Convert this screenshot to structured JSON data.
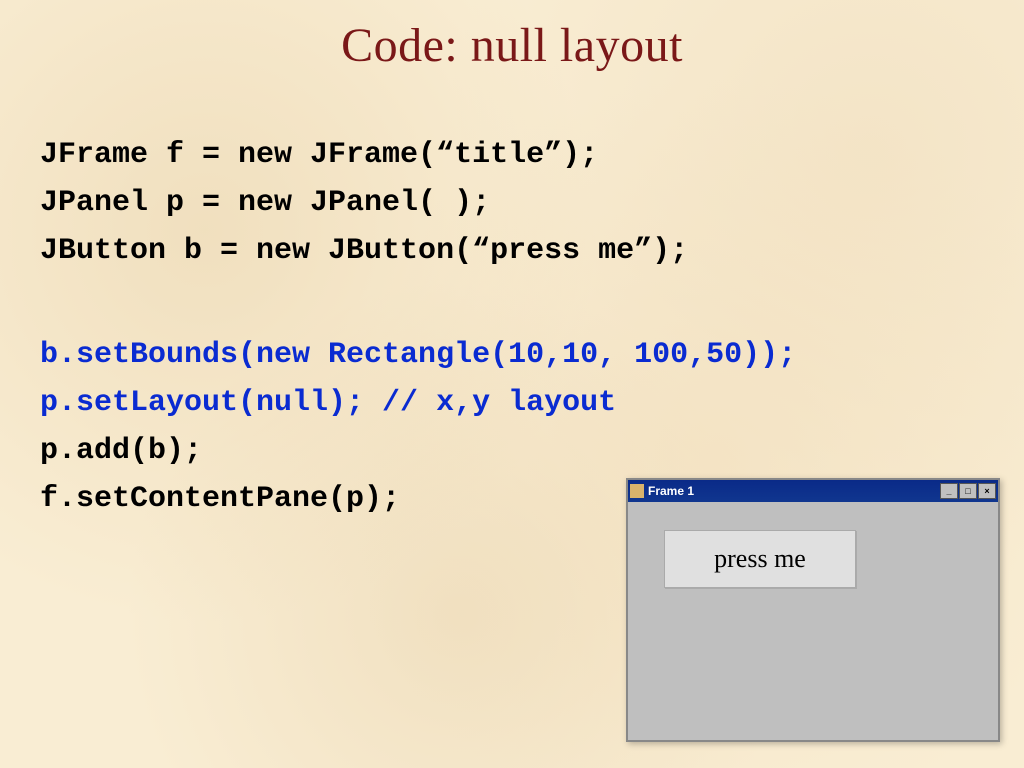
{
  "title": "Code:  null layout",
  "code": {
    "line1": "JFrame f = new JFrame(“title”);",
    "line2": "JPanel p = new JPanel( );",
    "line3": "JButton b = new JButton(“press me”);",
    "line4": "b.setBounds(new Rectangle(10,10, 100,50));",
    "line5": "p.setLayout(null);       // x,y layout",
    "line6": "p.add(b);",
    "line7": "f.setContentPane(p);"
  },
  "demo": {
    "frame_title": "Frame 1",
    "button_label": "press me",
    "min_glyph": "_",
    "max_glyph": "□",
    "close_glyph": "×"
  }
}
